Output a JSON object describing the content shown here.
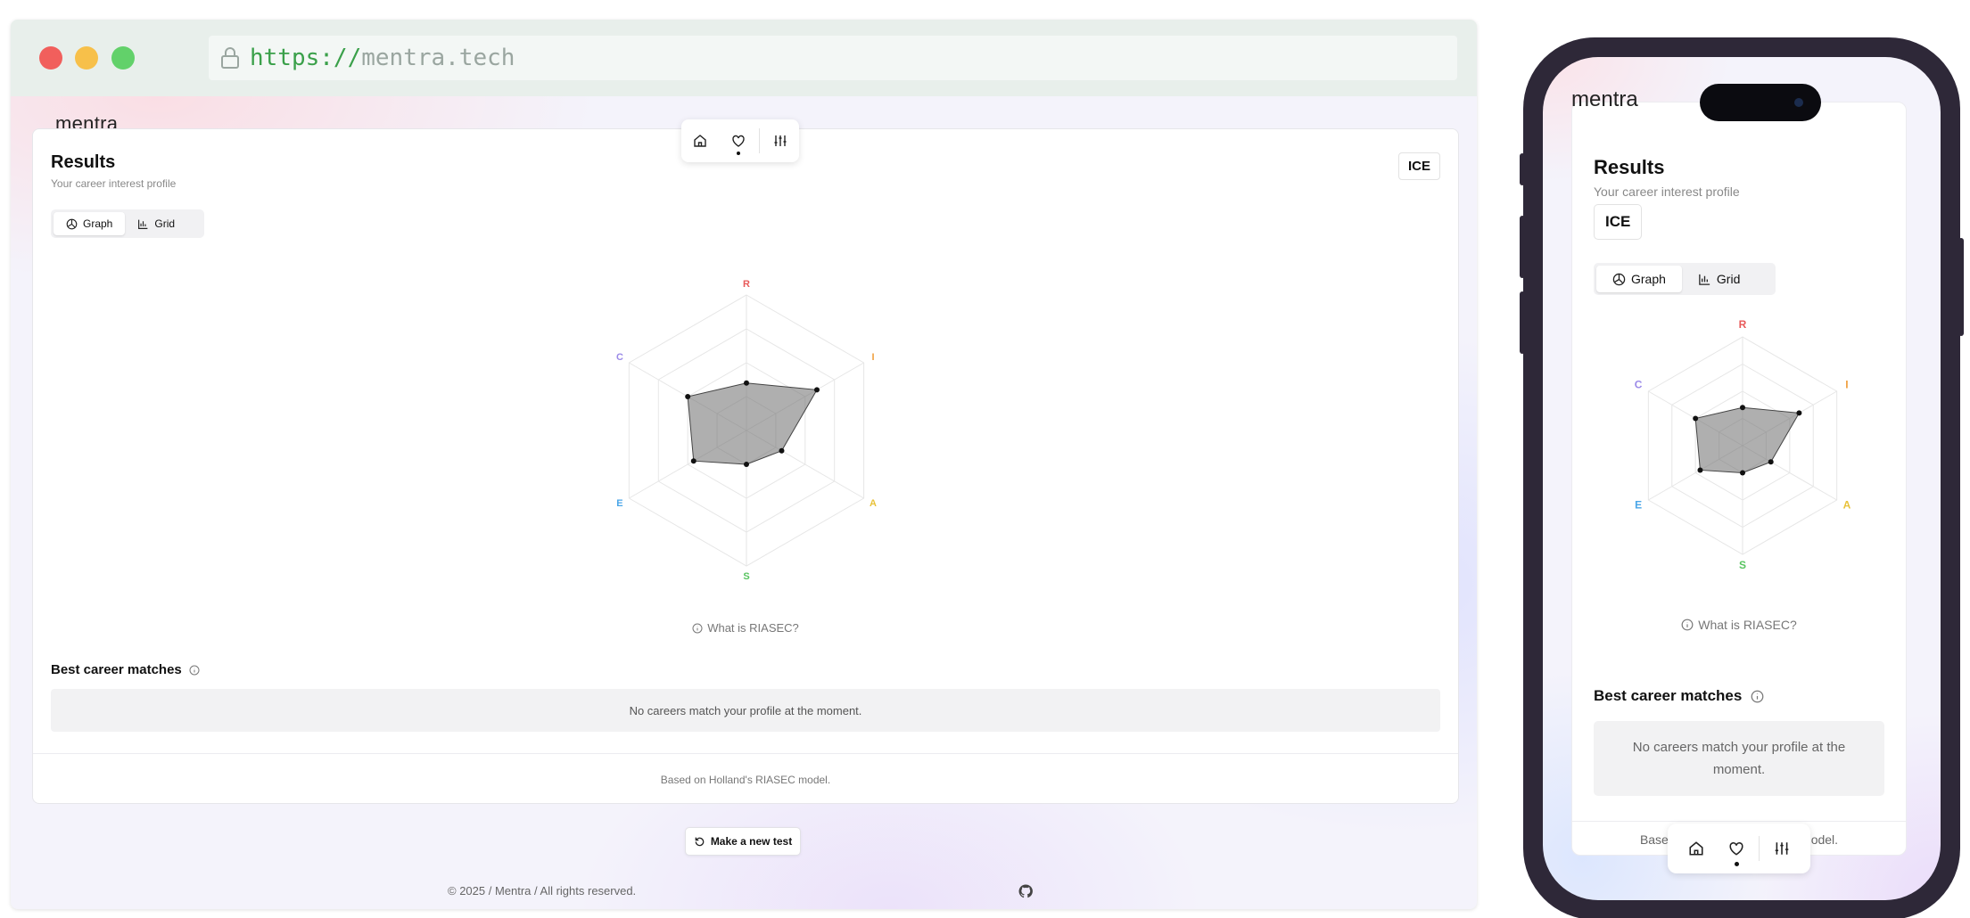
{
  "browser": {
    "url_scheme": "https://",
    "url_host": "mentra.tech"
  },
  "app": {
    "logo_text": "mentra"
  },
  "nav": {
    "items": [
      {
        "icon": "home-icon",
        "active": false
      },
      {
        "icon": "heart-icon",
        "active": true
      },
      {
        "icon": "sliders-icon",
        "active": false
      }
    ]
  },
  "results": {
    "title": "Results",
    "subtitle": "Your career interest profile",
    "code": "ICE",
    "view_toggle": {
      "graph_label": "Graph",
      "grid_label": "Grid",
      "selected": "Graph"
    },
    "riasec_link": "What is RIASEC?",
    "matches_title": "Best career matches",
    "no_matches": "No careers match your profile at the moment.",
    "footer_note": "Based on Holland's RIASEC model."
  },
  "actions": {
    "new_test_label": "Make a new test"
  },
  "footer": {
    "copyright": "© 2025 / Mentra / All rights reserved."
  },
  "chart_data": {
    "type": "radar",
    "axes": [
      {
        "label": "R",
        "color": "#e85a5a"
      },
      {
        "label": "I",
        "color": "#f0a040"
      },
      {
        "label": "A",
        "color": "#e8c23a"
      },
      {
        "label": "S",
        "color": "#58c460"
      },
      {
        "label": "E",
        "color": "#4aa6e8"
      },
      {
        "label": "C",
        "color": "#9b8ae8"
      }
    ],
    "values": [
      0.35,
      0.6,
      0.3,
      0.25,
      0.45,
      0.5
    ],
    "max": 1,
    "rings": 4
  }
}
